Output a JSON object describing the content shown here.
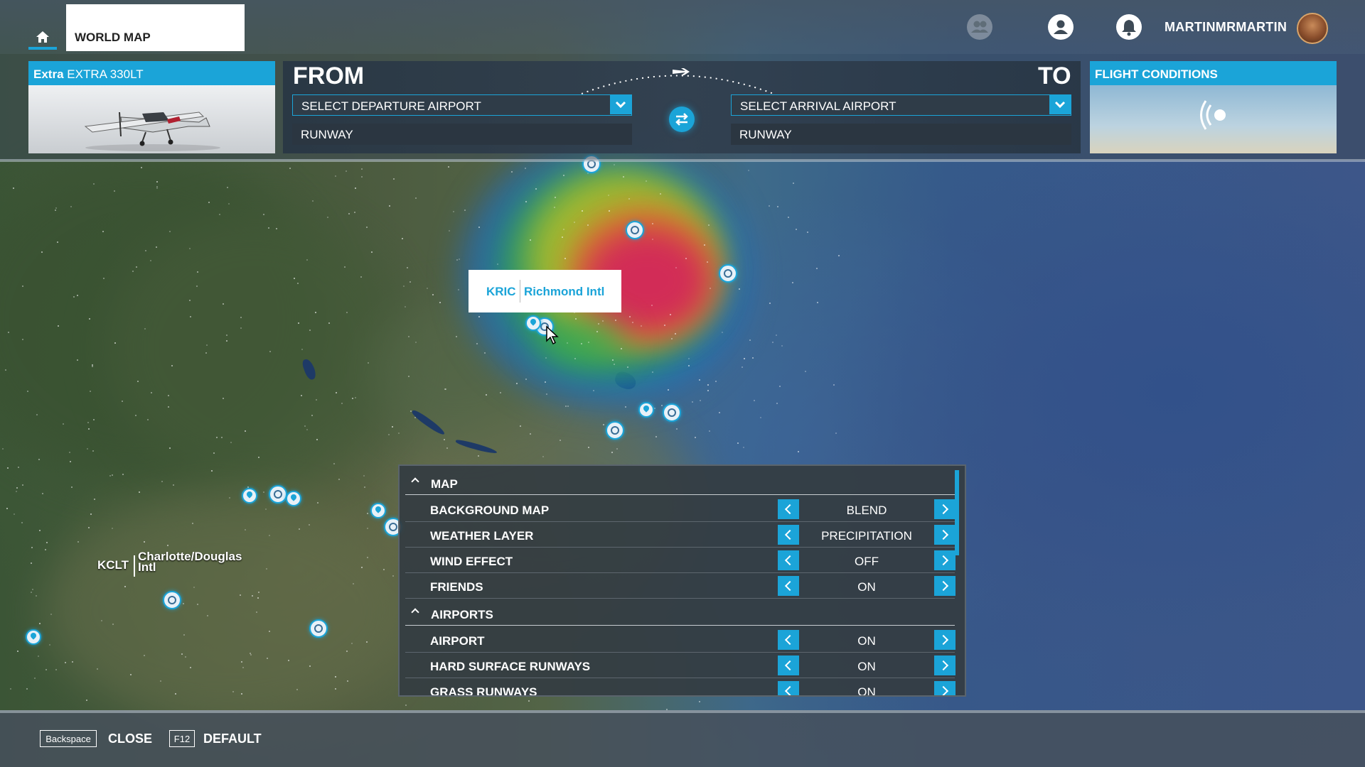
{
  "nav": {
    "tab_title": "WORLD MAP",
    "username": "MARTINMRMARTIN"
  },
  "aircraft": {
    "brand": "Extra",
    "model": "EXTRA 330LT"
  },
  "route": {
    "from_label": "FROM",
    "to_label": "TO",
    "departure_placeholder": "SELECT DEPARTURE AIRPORT",
    "arrival_placeholder": "SELECT ARRIVAL AIRPORT",
    "departure_runway": "RUNWAY",
    "arrival_runway": "RUNWAY"
  },
  "conditions": {
    "title": "FLIGHT CONDITIONS"
  },
  "map": {
    "tooltip": {
      "code": "KRIC",
      "name": "Richmond Intl"
    },
    "label_kclt": {
      "code": "KCLT",
      "name": "Charlotte/Douglas Intl"
    }
  },
  "settings": {
    "sections": [
      {
        "title": "MAP",
        "rows": [
          {
            "label": "BACKGROUND MAP",
            "value": "BLEND"
          },
          {
            "label": "WEATHER LAYER",
            "value": "PRECIPITATION"
          },
          {
            "label": "WIND EFFECT",
            "value": "OFF"
          },
          {
            "label": "FRIENDS",
            "value": "ON"
          }
        ]
      },
      {
        "title": "AIRPORTS",
        "rows": [
          {
            "label": "AIRPORT",
            "value": "ON"
          },
          {
            "label": "HARD SURFACE RUNWAYS",
            "value": "ON"
          },
          {
            "label": "GRASS RUNWAYS",
            "value": "ON"
          }
        ]
      }
    ]
  },
  "footer": {
    "close_key": "Backspace",
    "close_label": "CLOSE",
    "default_key": "F12",
    "default_label": "DEFAULT"
  },
  "colors": {
    "accent": "#1ba4d8",
    "panel": "#343c42"
  },
  "icons": {
    "home": "home-icon",
    "friends": "group-icon",
    "profile": "user-icon",
    "notifications": "bell-icon",
    "swap": "swap-arrows-icon"
  }
}
